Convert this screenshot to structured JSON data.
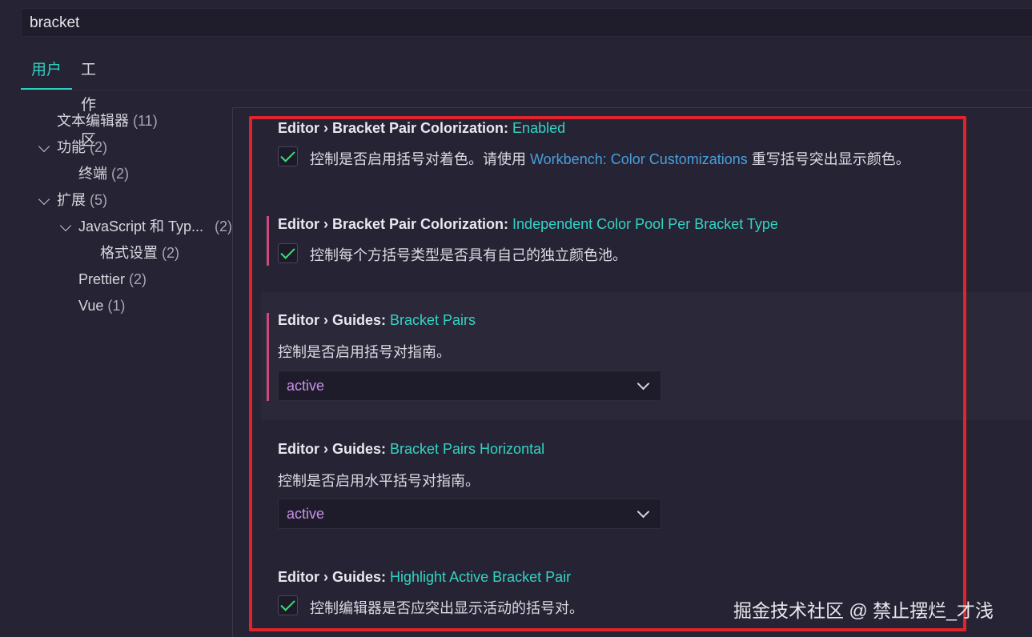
{
  "search": {
    "value": "bracket"
  },
  "tabs": [
    {
      "label": "用户",
      "active": true
    },
    {
      "label": "工作区",
      "active": false
    }
  ],
  "tree": [
    {
      "label": "文本编辑器",
      "count": "(11)"
    },
    {
      "label": "功能",
      "count": "(2)",
      "expanded": true
    },
    {
      "label": "终端",
      "count": "(2)"
    },
    {
      "label": "扩展",
      "count": "(5)",
      "expanded": true
    },
    {
      "label": "JavaScript 和 Typ...",
      "count": "(2)",
      "expanded": true
    },
    {
      "label": "格式设置",
      "count": "(2)"
    },
    {
      "label": "Prettier",
      "count": "(2)"
    },
    {
      "label": "Vue",
      "count": "(1)"
    }
  ],
  "settings": [
    {
      "category": "Editor › Bracket Pair Colorization: ",
      "key": "Enabled",
      "description_before": "控制是否启用括号对着色。请使用 ",
      "description_link": "Workbench: Color Customizations",
      "description_after": " 重写括号突出显示颜色。",
      "type": "checkbox",
      "checked": true
    },
    {
      "category": "Editor › Bracket Pair Colorization: ",
      "key": "Independent Color Pool Per Bracket Type",
      "description": "控制每个方括号类型是否具有自己的独立颜色池。",
      "type": "checkbox",
      "checked": true,
      "modified": true
    },
    {
      "category": "Editor › Guides: ",
      "key": "Bracket Pairs",
      "description": "控制是否启用括号对指南。",
      "type": "select",
      "value": "active",
      "modified": true
    },
    {
      "category": "Editor › Guides: ",
      "key": "Bracket Pairs Horizontal",
      "description": "控制是否启用水平括号对指南。",
      "type": "select",
      "value": "active"
    },
    {
      "category": "Editor › Guides: ",
      "key": "Highlight Active Bracket Pair",
      "description": "控制编辑器是否应突出显示活动的括号对。",
      "type": "checkbox",
      "checked": true
    }
  ],
  "watermark": "掘金技术社区 @ 禁止摆烂_才浅",
  "colors": {
    "accent": "#2fd0c0",
    "link": "#4a9edd",
    "modified_bar": "#c94c7c",
    "highlight_box": "#e0242d",
    "select_value": "#c792ea"
  }
}
